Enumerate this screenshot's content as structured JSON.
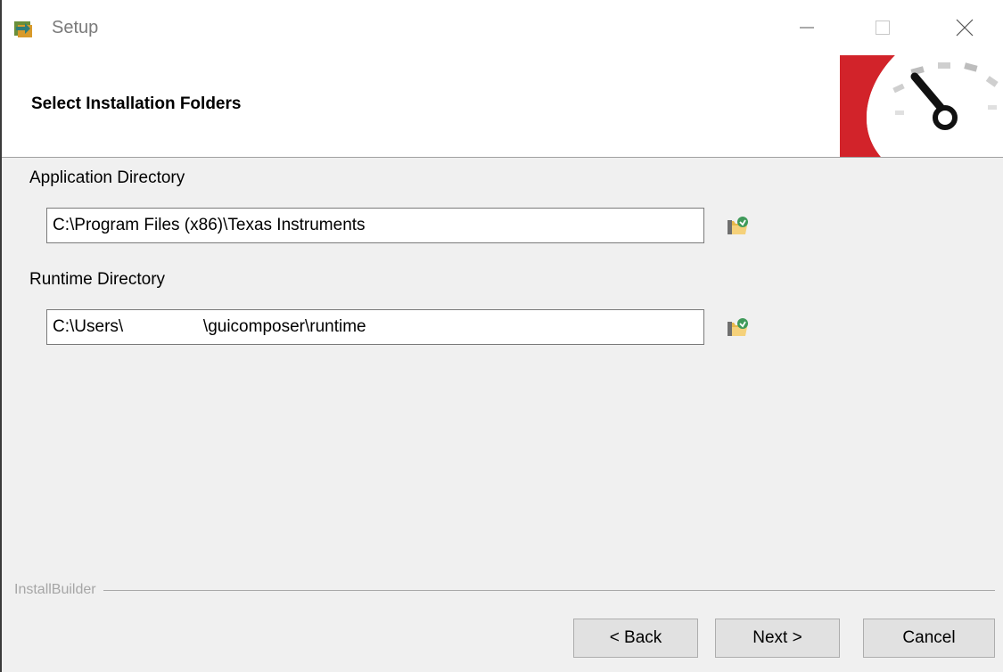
{
  "window": {
    "title": "Setup",
    "icon": "setup-app-icon",
    "controls": [
      "minimize-icon",
      "maximize-icon",
      "close-icon"
    ]
  },
  "header": {
    "title": "Select Installation Folders",
    "logo": "gauge-logo-icon",
    "accent_color": "#d2232a"
  },
  "application_directory": {
    "label": "Application Directory",
    "value": "C:\\Program Files (x86)\\Texas Instruments",
    "browse_icon": "folder-browse-icon"
  },
  "runtime_directory": {
    "label": "Runtime Directory",
    "value": "C:\\Users\\                 \\guicomposer\\runtime",
    "browse_icon": "folder-browse-icon"
  },
  "footer": {
    "brand": "InstallBuilder",
    "buttons": {
      "back": "< Back",
      "next": "Next >",
      "cancel": "Cancel"
    }
  }
}
